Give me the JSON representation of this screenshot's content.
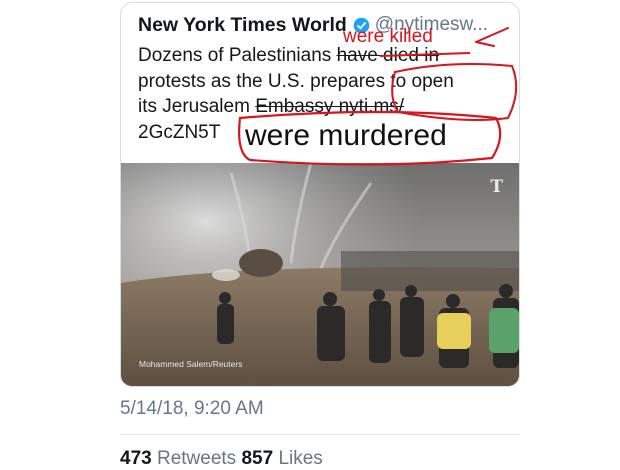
{
  "tweet": {
    "name": "New York Times World",
    "handle": "@nytimesw...",
    "verified_icon": "verified-badge-icon",
    "text_lines": [
      [
        "Dozens of Palestinians ",
        "have died in"
      ],
      [
        "protests as the U.S. prepares to open"
      ],
      [
        "its Jerusalem ",
        "Embassy nyti.ms/"
      ],
      [
        "2GcZN5T"
      ]
    ],
    "photo_credit": "Mohammed Salem/Reuters",
    "photo_logo": "T",
    "timestamp": "5/14/18, 9:20 AM",
    "stats": {
      "retweets_count": "473",
      "retweets_label": "Retweets",
      "likes_count": "857",
      "likes_label": "Likes"
    }
  },
  "annotations": {
    "correction_1": "were killed",
    "correction_2": "were murdered",
    "color": "#d8141c"
  },
  "colors": {
    "text": "#14171a",
    "secondary": "#657786",
    "verified": "#1da1f2",
    "annotation_red": "#d8141c"
  }
}
